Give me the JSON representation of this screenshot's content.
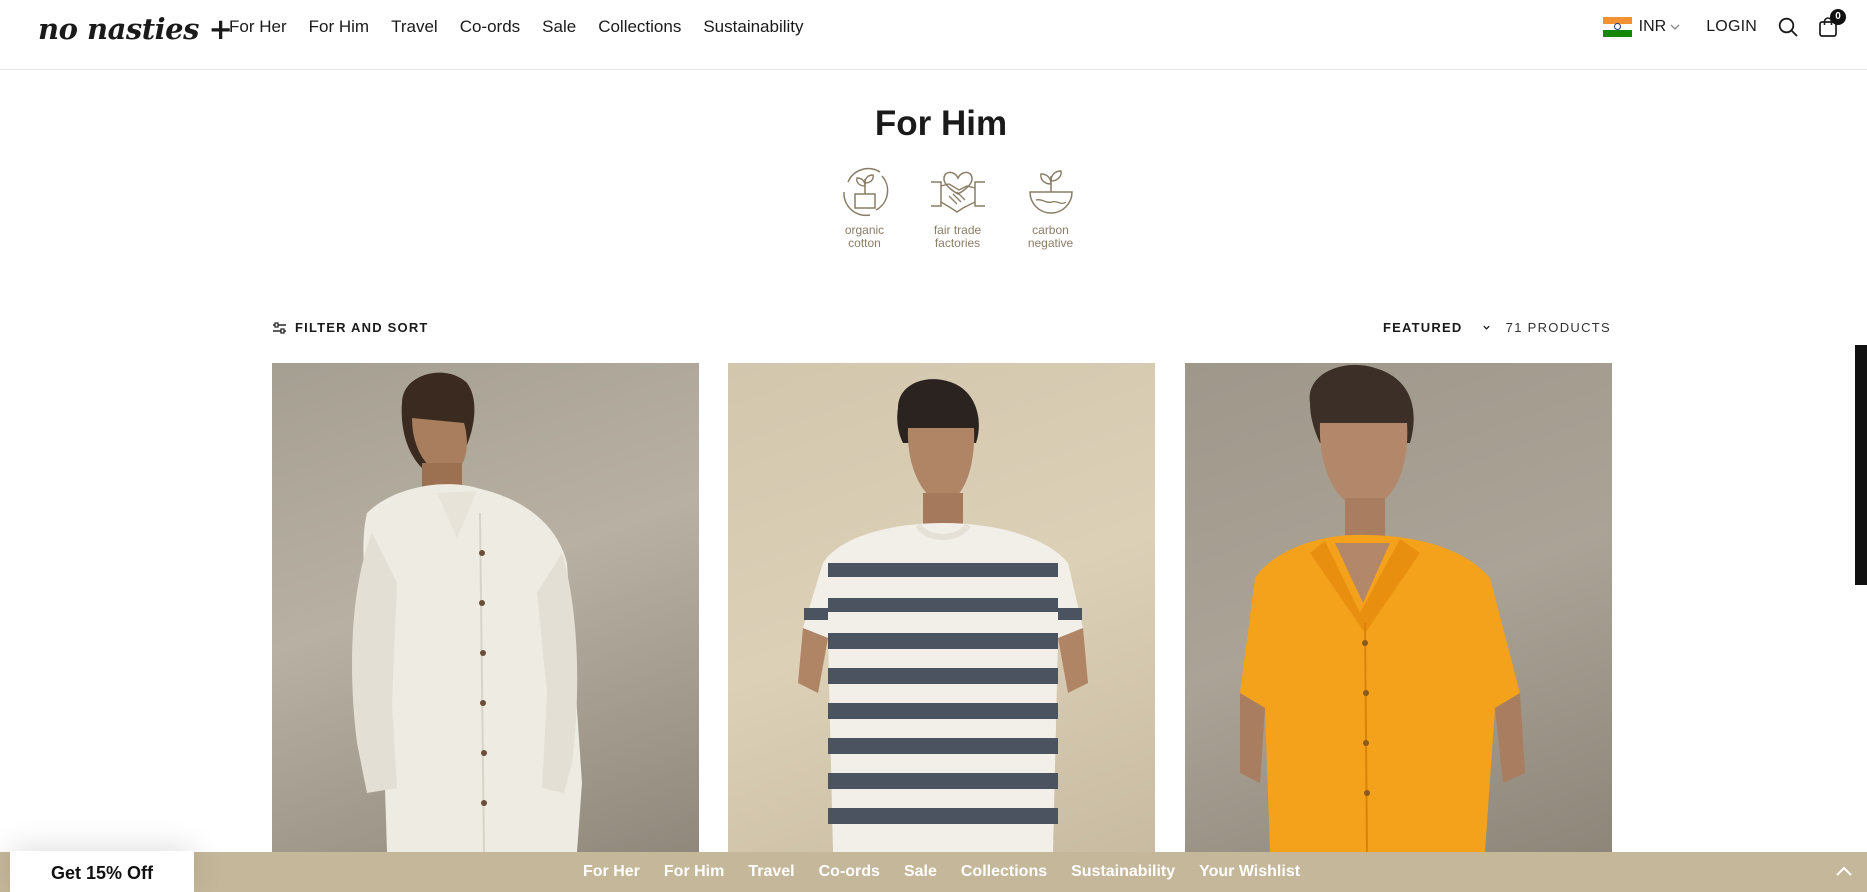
{
  "header": {
    "logo": "no nasties +",
    "nav": [
      "For Her",
      "For Him",
      "Travel",
      "Co-ords",
      "Sale",
      "Collections",
      "Sustainability"
    ],
    "currency": "INR",
    "login_label": "LOGIN",
    "cart_count": "0",
    "icons": {
      "search": "search-icon",
      "cart": "shopping-bag-icon",
      "currency_chevron": "chevron-down-icon",
      "flag": "india-flag-icon"
    }
  },
  "page": {
    "title": "For Him",
    "badges": [
      {
        "label": "organic\ncotton",
        "icon": "plant-pot-icon"
      },
      {
        "label": "fair trade\nfactories",
        "icon": "handshake-heart-icon"
      },
      {
        "label": "carbon\nnegative",
        "icon": "earth-sprout-icon"
      }
    ]
  },
  "toolbar": {
    "filter_label": "FILTER AND SORT",
    "sort_label": "FEATURED",
    "product_count": "71 PRODUCTS"
  },
  "products": [
    {
      "image": "white-linen-shirt"
    },
    {
      "image": "striped-tshirt"
    },
    {
      "image": "orange-camp-shirt"
    }
  ],
  "bottom_bar": {
    "promo_label": "Get 15% Off",
    "nav": [
      "For Her",
      "For Him",
      "Travel",
      "Co-ords",
      "Sale",
      "Collections",
      "Sustainability",
      "Your Wishlist"
    ]
  },
  "colors": {
    "bottom_bar_bg": "#c5b799",
    "badge_text": "#8a7d66",
    "text": "#1a1a1a"
  }
}
